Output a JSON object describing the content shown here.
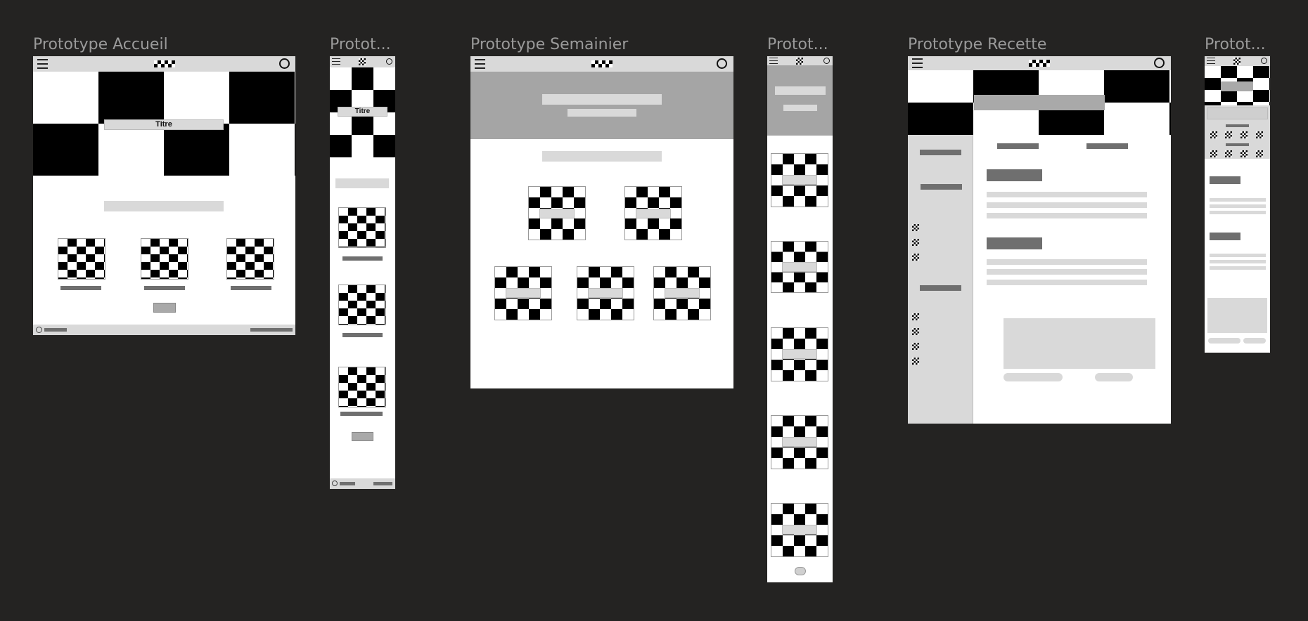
{
  "frames": [
    {
      "id": "accueil",
      "title": "Prototype Accueil",
      "hero_label": "Titre"
    },
    {
      "id": "accueil-mobile",
      "title": "Protot...",
      "hero_label": "Titre"
    },
    {
      "id": "semainier",
      "title": "Prototype Semainier"
    },
    {
      "id": "semainier-mobile",
      "title": "Protot..."
    },
    {
      "id": "recette",
      "title": "Prototype Recette"
    },
    {
      "id": "recette-mobile",
      "title": "Protot..."
    }
  ],
  "icons": {
    "menu": "hamburger-icon",
    "search": "search-icon",
    "logo": "checker-logo-icon",
    "copyright": "copyright-icon",
    "home": "home-icon"
  },
  "colors": {
    "canvas": "#242322",
    "frame": "#ffffff",
    "chrome": "#d9d9d9",
    "placeholder_dark": "#6f6f6f",
    "placeholder_mid": "#a9a9a9",
    "placeholder_light": "#d9d9d9",
    "title_text": "#9a9a9a"
  }
}
